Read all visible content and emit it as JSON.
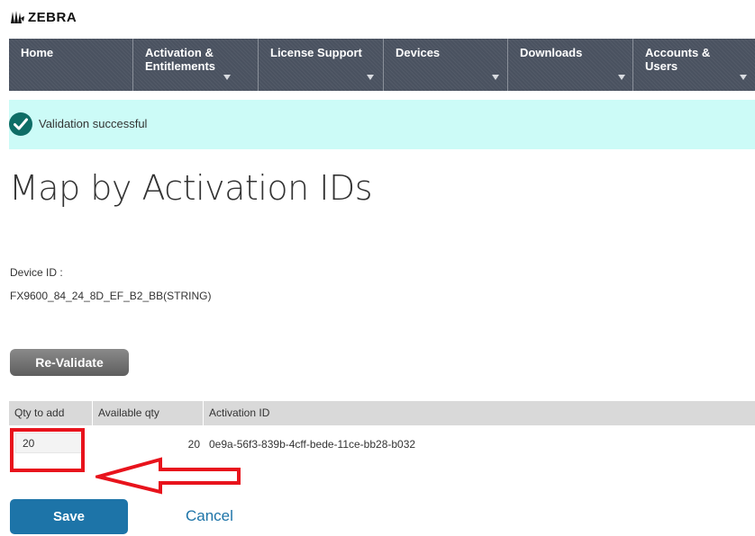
{
  "brand": {
    "name": "ZEBRA"
  },
  "nav": {
    "items": [
      {
        "label": "Home",
        "has_dropdown": false
      },
      {
        "label": "Activation &\nEntitlements",
        "has_dropdown": true
      },
      {
        "label": "License Support",
        "has_dropdown": true
      },
      {
        "label": "Devices",
        "has_dropdown": true
      },
      {
        "label": "Downloads",
        "has_dropdown": true
      },
      {
        "label": "Accounts &\nUsers",
        "has_dropdown": true
      }
    ]
  },
  "alert": {
    "icon": "check-circle-icon",
    "text": "Validation successful",
    "color": "#0e6d66",
    "background": "#ccfbf7"
  },
  "page": {
    "title": "Map by Activation IDs"
  },
  "device": {
    "label": "Device ID :",
    "value": "FX9600_84_24_8D_EF_B2_BB(STRING)"
  },
  "buttons": {
    "revalidate": "Re-Validate",
    "save": "Save",
    "cancel": "Cancel"
  },
  "table": {
    "headers": {
      "qty": "Qty to add",
      "available": "Available qty",
      "activation": "Activation ID"
    },
    "rows": [
      {
        "qty_to_add": "20",
        "available_qty": "20",
        "activation_id": "0e9a-56f3-839b-4cff-bede-11ce-bb28-b032"
      }
    ]
  },
  "annotation": {
    "color": "#e8131c",
    "shape": "red-arrow-pointing-left"
  }
}
